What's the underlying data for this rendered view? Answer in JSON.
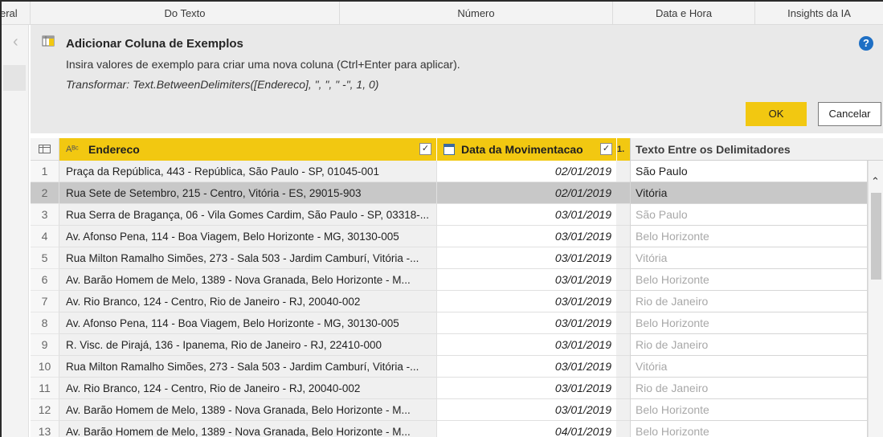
{
  "ribbon": {
    "groups": [
      "eral",
      "Do Texto",
      "Número",
      "Data e Hora",
      "Insights da IA"
    ]
  },
  "panel": {
    "title": "Adicionar Coluna de Exemplos",
    "description": "Insira valores de exemplo para criar uma nova coluna (Ctrl+Enter para aplicar).",
    "formula": "Transformar: Text.BetweenDelimiters([Endereco], \", \", \" -\", 1, 0)",
    "help_label": "?",
    "ok_label": "OK",
    "cancel_label": "Cancelar"
  },
  "grid": {
    "col_endereco": "Endereco",
    "col_endereco_type": "Aᴮᶜ",
    "col_data": "Data da Movimentacao",
    "col_more": "1.",
    "col_new": "Texto Entre os Delimitadores",
    "checkmark": "✓",
    "rows": [
      {
        "n": "1",
        "endereco": "Praça da República, 443 - República, São Paulo - SP, 01045-001",
        "data": "02/01/2019",
        "novo": "São Paulo"
      },
      {
        "n": "2",
        "endereco": "Rua Sete de Setembro, 215 - Centro, Vitória - ES, 29015-903",
        "data": "02/01/2019",
        "novo": "Vitória"
      },
      {
        "n": "3",
        "endereco": "Rua Serra de Bragança, 06 - Vila Gomes Cardim, São Paulo - SP, 03318-...",
        "data": "03/01/2019",
        "novo": "São Paulo"
      },
      {
        "n": "4",
        "endereco": "Av. Afonso Pena, 114 - Boa Viagem, Belo Horizonte - MG, 30130-005",
        "data": "03/01/2019",
        "novo": "Belo Horizonte"
      },
      {
        "n": "5",
        "endereco": "Rua Milton Ramalho Simões, 273 - Sala 503 - Jardim Camburí, Vitória -...",
        "data": "03/01/2019",
        "novo": "Vitória"
      },
      {
        "n": "6",
        "endereco": "Av. Barão Homem de Melo, 1389 - Nova Granada, Belo Horizonte - M...",
        "data": "03/01/2019",
        "novo": "Belo Horizonte"
      },
      {
        "n": "7",
        "endereco": "Av. Rio Branco, 124 - Centro, Rio de Janeiro - RJ, 20040-002",
        "data": "03/01/2019",
        "novo": "Rio de Janeiro"
      },
      {
        "n": "8",
        "endereco": "Av. Afonso Pena, 114 - Boa Viagem, Belo Horizonte - MG, 30130-005",
        "data": "03/01/2019",
        "novo": "Belo Horizonte"
      },
      {
        "n": "9",
        "endereco": "R. Visc. de Pirajá, 136 - Ipanema, Rio de Janeiro - RJ, 22410-000",
        "data": "03/01/2019",
        "novo": "Rio de Janeiro"
      },
      {
        "n": "10",
        "endereco": "Rua Milton Ramalho Simões, 273 - Sala 503 - Jardim Camburí, Vitória -...",
        "data": "03/01/2019",
        "novo": "Vitória"
      },
      {
        "n": "11",
        "endereco": "Av. Rio Branco, 124 - Centro, Rio de Janeiro - RJ, 20040-002",
        "data": "03/01/2019",
        "novo": "Rio de Janeiro"
      },
      {
        "n": "12",
        "endereco": "Av. Barão Homem de Melo, 1389 - Nova Granada, Belo Horizonte - M...",
        "data": "03/01/2019",
        "novo": "Belo Horizonte"
      },
      {
        "n": "13",
        "endereco": "Av. Barão Homem de Melo, 1389 - Nova Granada, Belo Horizonte - M...",
        "data": "04/01/2019",
        "novo": "Belo Horizonte"
      }
    ]
  },
  "colors": {
    "accent": "#f2c811",
    "selected_row": "#c8c8c8",
    "help_icon": "#1e6fc4"
  }
}
